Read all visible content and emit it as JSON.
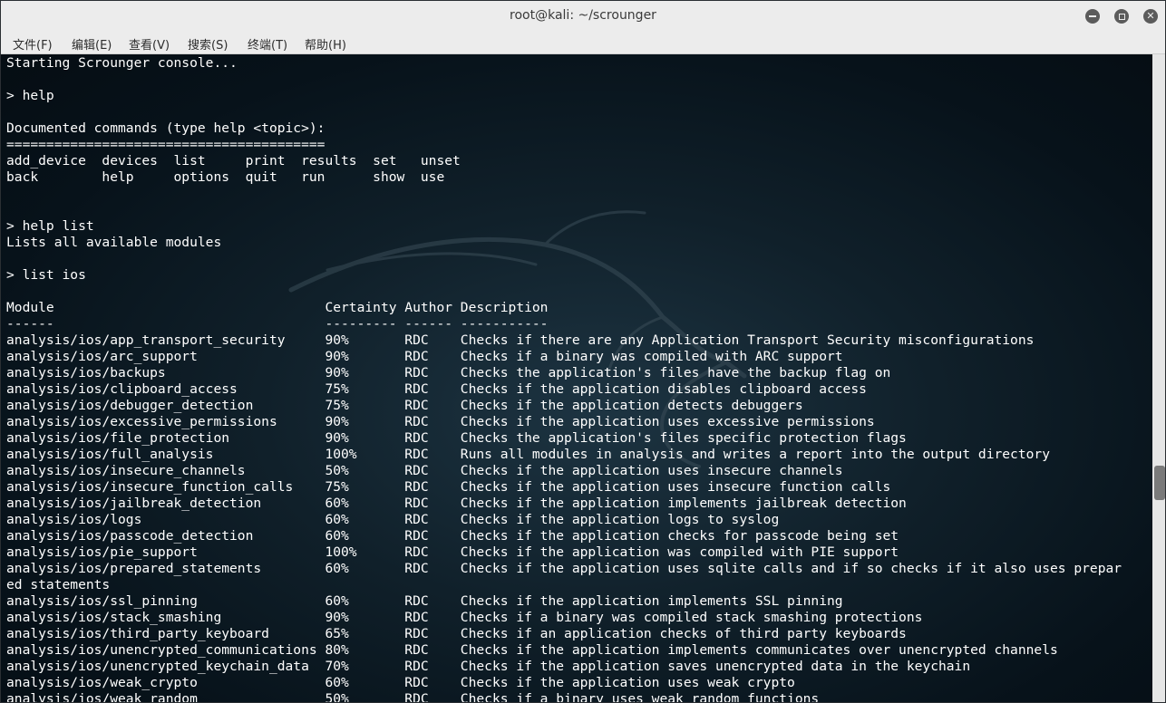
{
  "window": {
    "title": "root@kali: ~/scrounger"
  },
  "menubar": {
    "items": [
      "文件(F)",
      "编辑(E)",
      "查看(V)",
      "搜索(S)",
      "终端(T)",
      "帮助(H)"
    ]
  },
  "terminal": {
    "lines": [
      "Starting Scrounger console...",
      "",
      "> help",
      "",
      "Documented commands (type help <topic>):",
      "========================================",
      "add_device  devices  list     print  results  set   unset",
      "back        help     options  quit   run      show  use",
      "",
      "",
      "> help list",
      "Lists all available modules",
      "",
      "> list ios",
      "",
      "Module                                  Certainty Author Description",
      "------                                  --------- ------ -----------",
      "analysis/ios/app_transport_security     90%       RDC    Checks if there are any Application Transport Security misconfigurations",
      "analysis/ios/arc_support                90%       RDC    Checks if a binary was compiled with ARC support",
      "analysis/ios/backups                    90%       RDC    Checks the application's files have the backup flag on",
      "analysis/ios/clipboard_access           75%       RDC    Checks if the application disables clipboard access",
      "analysis/ios/debugger_detection         75%       RDC    Checks if the application detects debuggers",
      "analysis/ios/excessive_permissions      90%       RDC    Checks if the application uses excessive permissions",
      "analysis/ios/file_protection            90%       RDC    Checks the application's files specific protection flags",
      "analysis/ios/full_analysis              100%      RDC    Runs all modules in analysis and writes a report into the output directory",
      "analysis/ios/insecure_channels          50%       RDC    Checks if the application uses insecure channels",
      "analysis/ios/insecure_function_calls    75%       RDC    Checks if the application uses insecure function calls",
      "analysis/ios/jailbreak_detection        60%       RDC    Checks if the application implements jailbreak detection",
      "analysis/ios/logs                       60%       RDC    Checks if the application logs to syslog",
      "analysis/ios/passcode_detection         60%       RDC    Checks if the application checks for passcode being set",
      "analysis/ios/pie_support                100%      RDC    Checks if the application was compiled with PIE support",
      "analysis/ios/prepared_statements        60%       RDC    Checks if the application uses sqlite calls and if so checks if it also uses prepar",
      "ed statements",
      "analysis/ios/ssl_pinning                60%       RDC    Checks if the application implements SSL pinning",
      "analysis/ios/stack_smashing             90%       RDC    Checks if a binary was compiled stack smashing protections",
      "analysis/ios/third_party_keyboard       65%       RDC    Checks if an application checks of third party keyboards",
      "analysis/ios/unencrypted_communications 80%       RDC    Checks if the application implements communicates over unencrypted channels",
      "analysis/ios/unencrypted_keychain_data  70%       RDC    Checks if the application saves unencrypted data in the keychain",
      "analysis/ios/weak_crypto                60%       RDC    Checks if the application uses weak crypto",
      "analysis/ios/weak_random                50%       RDC    Checks if a binary uses weak random functions"
    ]
  }
}
